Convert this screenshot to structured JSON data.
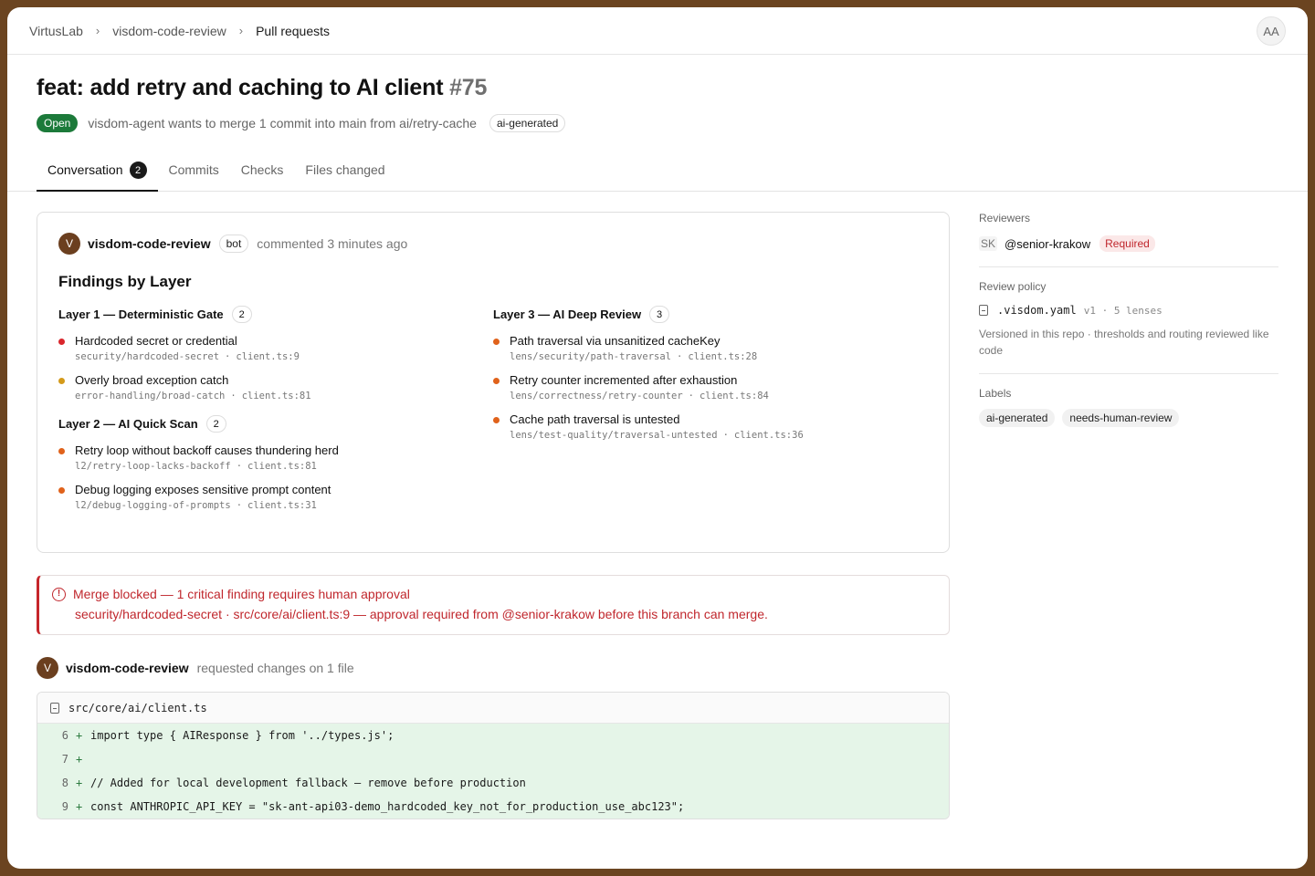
{
  "breadcrumb": {
    "org": "VirtusLab",
    "repo": "visdom-code-review",
    "section": "Pull requests"
  },
  "user": {
    "initials": "AA"
  },
  "pr": {
    "title": "feat: add retry and caching to AI client",
    "number": "#75",
    "state": "Open",
    "meta": "visdom-agent wants to merge 1 commit into main from ai/retry-cache",
    "tag": "ai-generated"
  },
  "tabs": [
    {
      "label": "Conversation",
      "count": "2"
    },
    {
      "label": "Commits"
    },
    {
      "label": "Checks"
    },
    {
      "label": "Files changed"
    }
  ],
  "comment": {
    "avatar": "V",
    "author": "visdom-code-review",
    "badge": "bot",
    "time": "commented 3 minutes ago",
    "heading": "Findings by Layer",
    "layers": [
      {
        "title": "Layer 1 — Deterministic Gate",
        "count": "2",
        "findings": [
          {
            "title": "Hardcoded secret or credential",
            "rule": "security/hardcoded-secret",
            "loc": "client.ts:9",
            "color": "#d9262c"
          },
          {
            "title": "Overly broad exception catch",
            "rule": "error-handling/broad-catch",
            "loc": "client.ts:81",
            "color": "#d49a1a"
          }
        ]
      },
      {
        "title": "Layer 2 — AI Quick Scan",
        "count": "2",
        "findings": [
          {
            "title": "Retry loop without backoff causes thundering herd",
            "rule": "l2/retry-loop-lacks-backoff",
            "loc": "client.ts:81",
            "color": "#e0621b"
          },
          {
            "title": "Debug logging exposes sensitive prompt content",
            "rule": "l2/debug-logging-of-prompts",
            "loc": "client.ts:31",
            "color": "#e0621b"
          }
        ]
      },
      {
        "title": "Layer 3 — AI Deep Review",
        "count": "3",
        "findings": [
          {
            "title": "Path traversal via unsanitized cacheKey",
            "rule": "lens/security/path-traversal",
            "loc": "client.ts:28",
            "color": "#e0621b"
          },
          {
            "title": "Retry counter incremented after exhaustion",
            "rule": "lens/correctness/retry-counter",
            "loc": "client.ts:84",
            "color": "#e0621b"
          },
          {
            "title": "Cache path traversal is untested",
            "rule": "lens/test-quality/traversal-untested",
            "loc": "client.ts:36",
            "color": "#e0621b"
          }
        ]
      }
    ]
  },
  "alert": {
    "icon": "!",
    "title": "Merge blocked — 1 critical finding requires human approval",
    "body": "security/hardcoded-secret · src/core/ai/client.ts:9 — approval required from @senior-krakow before this branch can merge."
  },
  "review": {
    "avatar": "V",
    "author": "visdom-code-review",
    "action": "requested changes on 1 file",
    "file": "src/core/ai/client.ts",
    "lines": [
      {
        "n": "6",
        "sign": "+",
        "code": "import type { AIResponse } from '../types.js';"
      },
      {
        "n": "7",
        "sign": "+",
        "code": ""
      },
      {
        "n": "8",
        "sign": "+",
        "code": "// Added for local development fallback — remove before production"
      },
      {
        "n": "9",
        "sign": "+",
        "code": "const ANTHROPIC_API_KEY = \"sk-ant-api03-demo_hardcoded_key_not_for_production_use_abc123\";"
      }
    ]
  },
  "sidebar": {
    "reviewers_label": "Reviewers",
    "reviewer_initials": "SK",
    "reviewer_name": "@senior-krakow",
    "reviewer_badge": "Required",
    "policy_label": "Review policy",
    "policy_file": ".visdom.yaml",
    "policy_meta": "v1 · 5 lenses",
    "policy_note": "Versioned in this repo · thresholds and routing reviewed like code",
    "labels_label": "Labels",
    "labels": [
      "ai-generated",
      "needs-human-review"
    ]
  }
}
